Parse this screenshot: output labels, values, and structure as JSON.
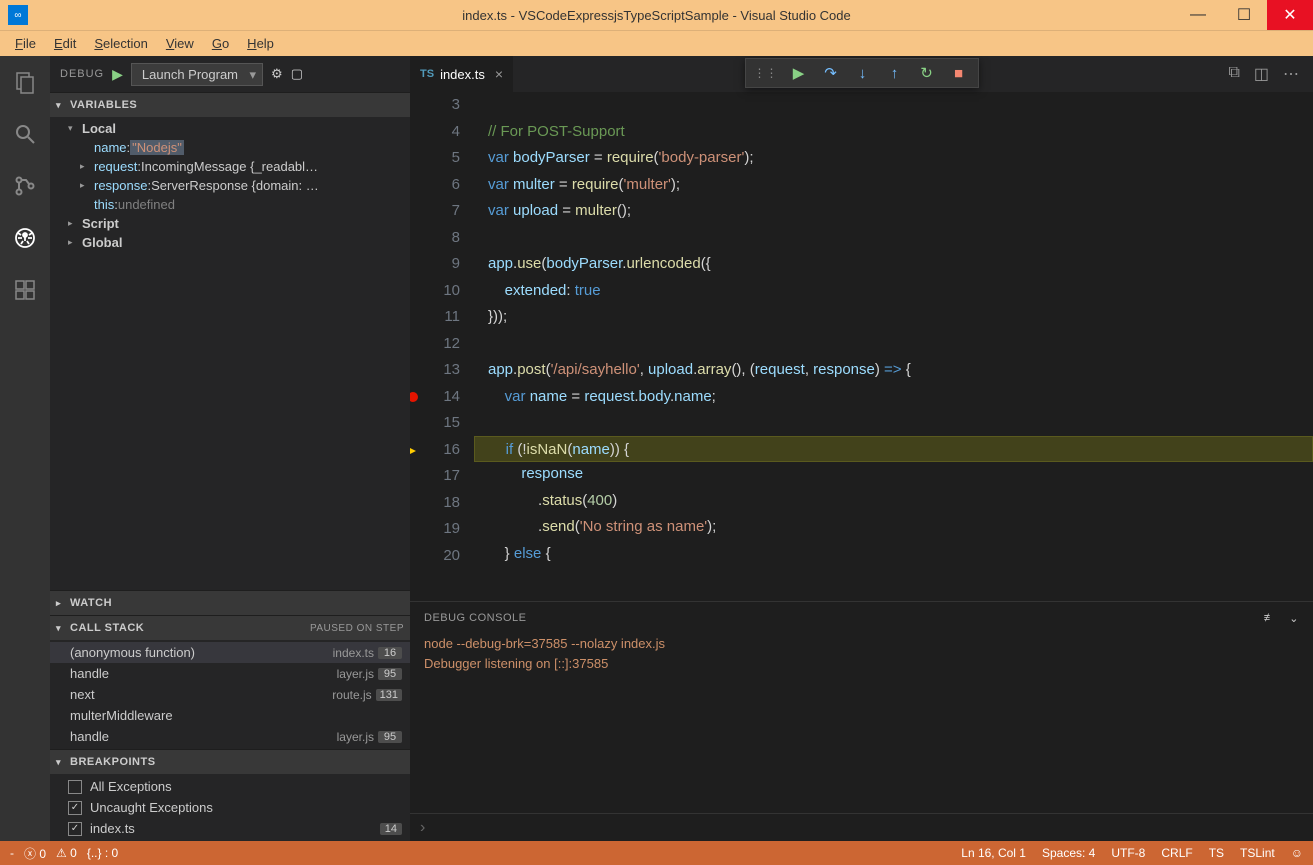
{
  "window": {
    "title": "index.ts - VSCodeExpressjsTypeScriptSample - Visual Studio Code"
  },
  "menubar": [
    "File",
    "Edit",
    "Selection",
    "View",
    "Go",
    "Help"
  ],
  "debug": {
    "label": "DEBUG",
    "launch_config": "Launch Program"
  },
  "variables": {
    "header": "VARIABLES",
    "local_label": "Local",
    "rows": [
      {
        "key": "name",
        "sep": ": ",
        "val": "\"Nodejs\"",
        "highlighted": true
      },
      {
        "key": "request",
        "sep": ": ",
        "type": "IncomingMessage {_readabl…",
        "expandable": true
      },
      {
        "key": "response",
        "sep": ": ",
        "type": "ServerResponse {domain: …",
        "expandable": true
      },
      {
        "key": "this",
        "sep": ": ",
        "undef": "undefined"
      }
    ],
    "script_label": "Script",
    "global_label": "Global"
  },
  "watch": {
    "header": "WATCH"
  },
  "callstack": {
    "header": "CALL STACK",
    "status": "PAUSED ON STEP",
    "rows": [
      {
        "fn": "(anonymous function)",
        "file": "index.ts",
        "line": "16"
      },
      {
        "fn": "handle",
        "file": "layer.js",
        "line": "95"
      },
      {
        "fn": "next",
        "file": "route.js",
        "line": "131"
      },
      {
        "fn": "multerMiddleware",
        "file": "",
        "line": ""
      },
      {
        "fn": "handle",
        "file": "layer.js",
        "line": "95"
      }
    ]
  },
  "breakpoints": {
    "header": "BREAKPOINTS",
    "rows": [
      {
        "checked": false,
        "label": "All Exceptions"
      },
      {
        "checked": true,
        "label": "Uncaught Exceptions"
      },
      {
        "checked": true,
        "label": "index.ts",
        "badge": "14"
      }
    ]
  },
  "tab": {
    "name": "index.ts",
    "lang": "TS"
  },
  "editor_lines": [
    {
      "n": 3,
      "html": ""
    },
    {
      "n": 4,
      "html": "<span class='tk-comment'>// For POST-Support</span>"
    },
    {
      "n": 5,
      "html": "<span class='tk-keyword'>var</span> <span class='tk-var'>bodyParser</span> <span class='tk-punc'>=</span> <span class='tk-fn'>require</span><span class='tk-punc'>(</span><span class='tk-str'>'body-parser'</span><span class='tk-punc'>);</span>"
    },
    {
      "n": 6,
      "html": "<span class='tk-keyword'>var</span> <span class='tk-var'>multer</span> <span class='tk-punc'>=</span> <span class='tk-fn'>require</span><span class='tk-punc'>(</span><span class='tk-str'>'multer'</span><span class='tk-punc'>);</span>"
    },
    {
      "n": 7,
      "html": "<span class='tk-keyword'>var</span> <span class='tk-var'>upload</span> <span class='tk-punc'>=</span> <span class='tk-fn'>multer</span><span class='tk-punc'>();</span>"
    },
    {
      "n": 8,
      "html": ""
    },
    {
      "n": 9,
      "html": "<span class='tk-var'>app</span><span class='tk-punc'>.</span><span class='tk-fn'>use</span><span class='tk-punc'>(</span><span class='tk-var'>bodyParser</span><span class='tk-punc'>.</span><span class='tk-fn'>urlencoded</span><span class='tk-punc'>({</span>"
    },
    {
      "n": 10,
      "html": "    <span class='tk-var'>extended</span><span class='tk-punc'>:</span> <span class='tk-keyword'>true</span>"
    },
    {
      "n": 11,
      "html": "<span class='tk-punc'>}));</span>"
    },
    {
      "n": 12,
      "html": ""
    },
    {
      "n": 13,
      "html": "<span class='tk-var'>app</span><span class='tk-punc'>.</span><span class='tk-fn'>post</span><span class='tk-punc'>(</span><span class='tk-str'>'/api/sayhello'</span><span class='tk-punc'>,</span> <span class='tk-var'>upload</span><span class='tk-punc'>.</span><span class='tk-fn'>array</span><span class='tk-punc'>(), (</span><span class='tk-var'>request</span><span class='tk-punc'>,</span> <span class='tk-var'>response</span><span class='tk-punc'>)</span> <span class='tk-keyword'>=&gt;</span> <span class='tk-punc'>{</span>"
    },
    {
      "n": 14,
      "html": "    <span class='tk-keyword'>var</span> <span class='tk-var'>name</span> <span class='tk-punc'>=</span> <span class='tk-var'>request</span><span class='tk-punc'>.</span><span class='tk-var'>body</span><span class='tk-punc'>.</span><span class='tk-var'>name</span><span class='tk-punc'>;</span>",
      "bp": true
    },
    {
      "n": 15,
      "html": ""
    },
    {
      "n": 16,
      "html": "    <span class='tk-keyword'>if</span> <span class='tk-punc'>(!</span><span class='tk-fn'>isNaN</span><span class='tk-punc'>(</span><span class='tk-var'>name</span><span class='tk-punc'>)) {</span>",
      "exec": true
    },
    {
      "n": 17,
      "html": "        <span class='tk-var'>response</span>"
    },
    {
      "n": 18,
      "html": "            <span class='tk-punc'>.</span><span class='tk-fn'>status</span><span class='tk-punc'>(</span><span class='tk-num'>400</span><span class='tk-punc'>)</span>"
    },
    {
      "n": 19,
      "html": "            <span class='tk-punc'>.</span><span class='tk-fn'>send</span><span class='tk-punc'>(</span><span class='tk-str'>'No string as name'</span><span class='tk-punc'>);</span>"
    },
    {
      "n": 20,
      "html": "    <span class='tk-punc'>}</span> <span class='tk-keyword'>else</span> <span class='tk-punc'>{</span>"
    }
  ],
  "debug_console": {
    "header": "DEBUG CONSOLE",
    "lines": [
      "node --debug-brk=37585 --nolazy index.js",
      "Debugger listening on [::]:37585"
    ]
  },
  "statusbar": {
    "errors": "0",
    "warnings": "0",
    "braces": "{..} : 0",
    "position": "Ln 16, Col 1",
    "spaces": "Spaces: 4",
    "encoding": "UTF-8",
    "eol": "CRLF",
    "lang": "TS",
    "linter": "TSLint"
  }
}
